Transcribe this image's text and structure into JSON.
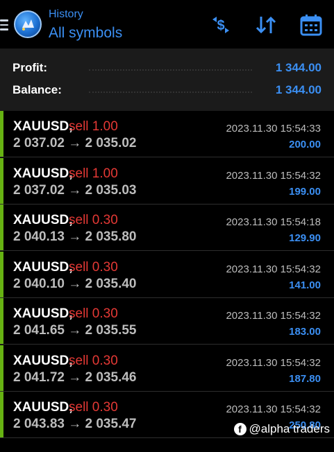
{
  "header": {
    "subtitle": "History",
    "title": "All symbols"
  },
  "summary": {
    "profit_label": "Profit:",
    "profit_value": "1 344.00",
    "balance_label": "Balance:",
    "balance_value": "1 344.00"
  },
  "trades": [
    {
      "symbol": "XAUUSD,",
      "side": "sell 1.00",
      "prices": "2 037.02 → 2 035.02",
      "time": "2023.11.30 15:54:33",
      "profit": "200.00"
    },
    {
      "symbol": "XAUUSD,",
      "side": "sell 1.00",
      "prices": "2 037.02 → 2 035.03",
      "time": "2023.11.30 15:54:32",
      "profit": "199.00"
    },
    {
      "symbol": "XAUUSD,",
      "side": "sell 0.30",
      "prices": "2 040.13 → 2 035.80",
      "time": "2023.11.30 15:54:18",
      "profit": "129.90"
    },
    {
      "symbol": "XAUUSD,",
      "side": "sell 0.30",
      "prices": "2 040.10 → 2 035.40",
      "time": "2023.11.30 15:54:32",
      "profit": "141.00"
    },
    {
      "symbol": "XAUUSD,",
      "side": "sell 0.30",
      "prices": "2 041.65 → 2 035.55",
      "time": "2023.11.30 15:54:32",
      "profit": "183.00"
    },
    {
      "symbol": "XAUUSD,",
      "side": "sell 0.30",
      "prices": "2 041.72 → 2 035.46",
      "time": "2023.11.30 15:54:32",
      "profit": "187.80"
    },
    {
      "symbol": "XAUUSD,",
      "side": "sell 0.30",
      "prices": "2 043.83 → 2 035.47",
      "time": "2023.11.30 15:54:32",
      "profit": "250.80"
    }
  ],
  "watermark": {
    "icon": "facebook-icon",
    "text": "@alpha traders"
  },
  "icons": {
    "menu": "hamburger-menu-icon",
    "logo": "metatrader-logo",
    "currency": "dollar-exchange-icon",
    "sort": "sort-arrows-icon",
    "calendar": "calendar-icon"
  },
  "colors": {
    "accent": "#3b8ff3",
    "sell": "#e53935",
    "profit_bar": "#66b212",
    "background": "#000000",
    "summary_bg": "#1b1b1b"
  }
}
